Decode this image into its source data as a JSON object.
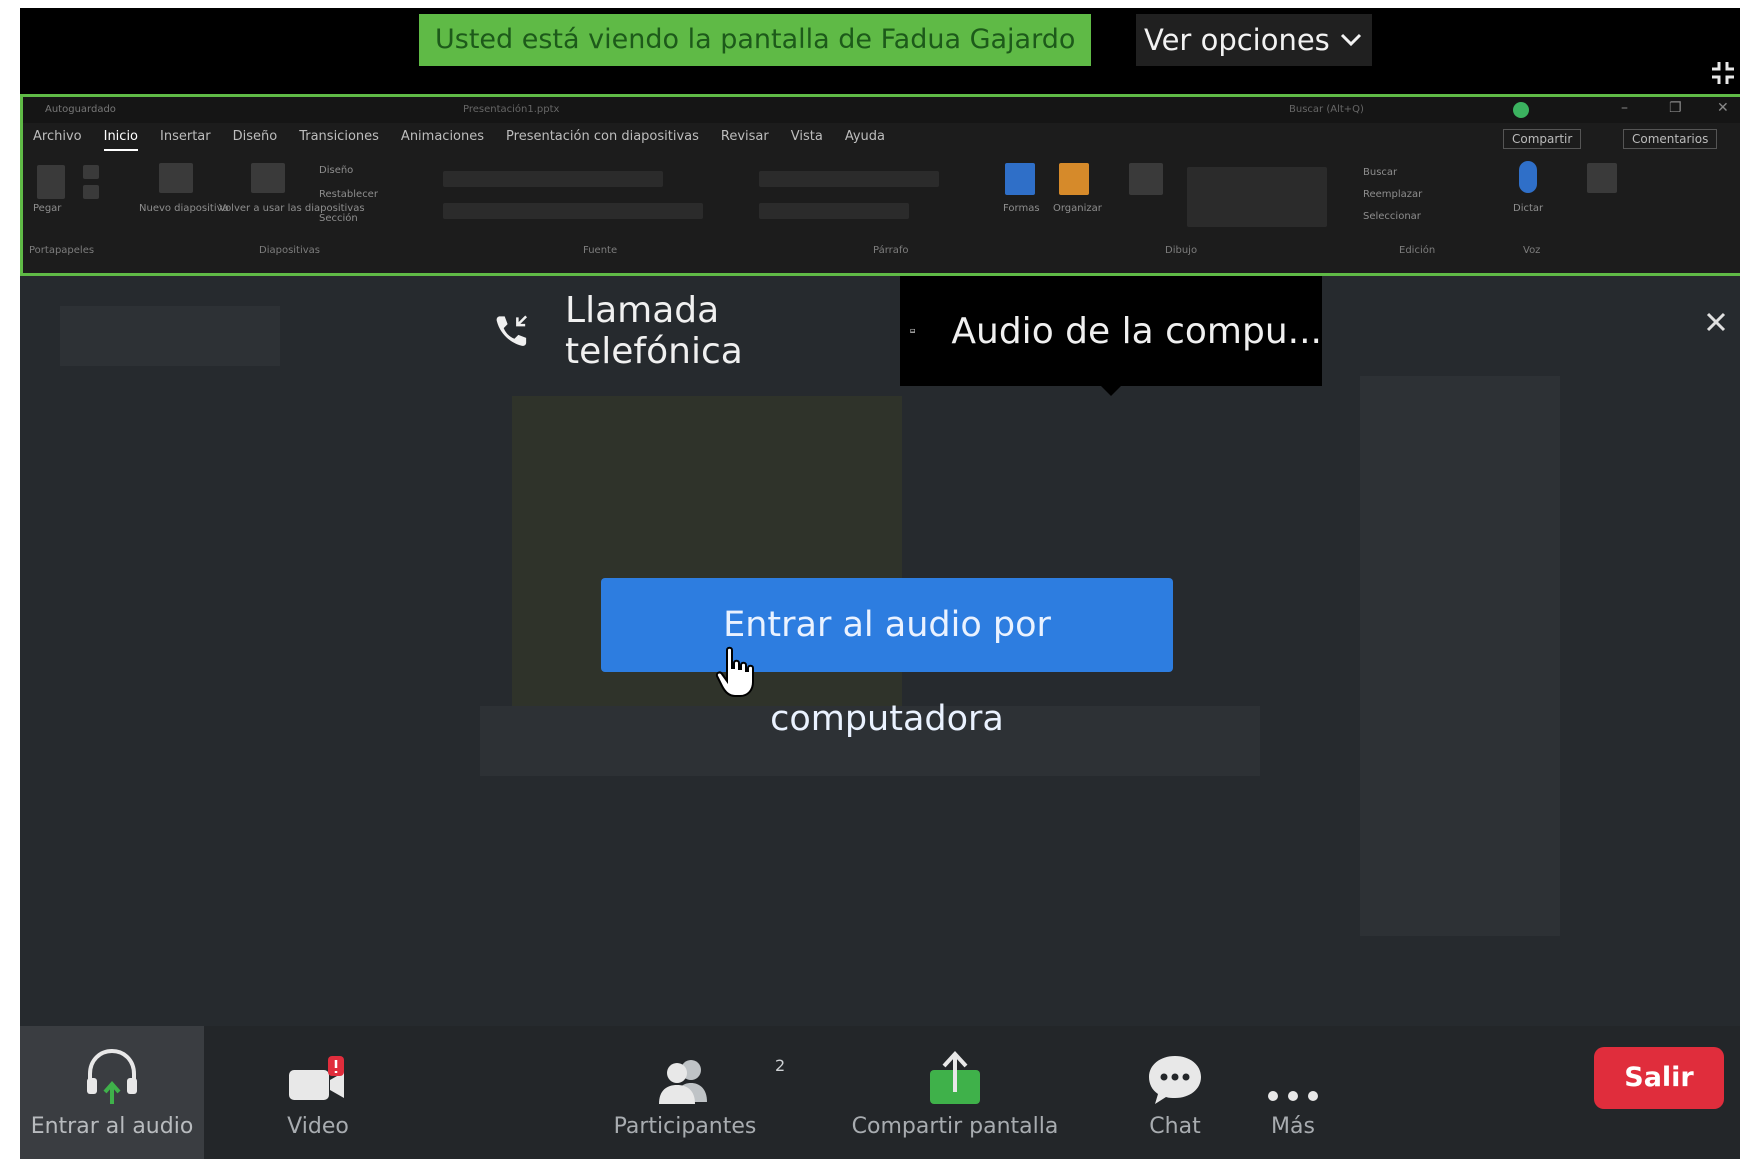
{
  "banner": {
    "sharing_text": "Usted está viendo la pantalla de Fadua Gajardo",
    "view_options_label": "Ver opciones"
  },
  "shared_screen": {
    "titlebar_left": "Autoguardado",
    "titlebar_file": "Presentación1.pptx",
    "titlebar_search": "Buscar (Alt+Q)",
    "ribbon_tabs": [
      "Archivo",
      "Inicio",
      "Insertar",
      "Diseño",
      "Transiciones",
      "Animaciones",
      "Presentación con diapositivas",
      "Revisar",
      "Vista",
      "Ayuda"
    ],
    "active_tab": "Inicio",
    "share_label": "Compartir",
    "comments_label": "Comentarios",
    "ribbon_items": {
      "paste": "Pegar",
      "new_slide": "Nuevo diapositiva",
      "reuse_slides": "Volver a usar las diapositivas",
      "layout": "Diseño",
      "reset": "Restablecer",
      "section": "Sección",
      "shapes": "Formas",
      "arrange": "Organizar",
      "search": "Buscar",
      "replace": "Reemplazar",
      "select": "Seleccionar",
      "dictate": "Dictar"
    },
    "group_labels": [
      "Portapapeles",
      "Diapositivas",
      "Fuente",
      "Párrafo",
      "Dibujo",
      "Edición",
      "Voz"
    ]
  },
  "audio_dialog": {
    "phone_tab_label": "Llamada telefónica",
    "computer_tab_label": "Audio de la compu...",
    "join_button_label": "Entrar al audio por computadora"
  },
  "toolbar": {
    "audio_label": "Entrar al audio",
    "video_label": "Video",
    "participants_label": "Participantes",
    "participants_count": "2",
    "share_label": "Compartir pantalla",
    "chat_label": "Chat",
    "more_label": "Más",
    "exit_label": "Salir"
  },
  "colors": {
    "banner_green": "#5fba46",
    "join_blue": "#2d7de0",
    "exit_red": "#e02d3c",
    "share_green": "#3fb14a"
  }
}
